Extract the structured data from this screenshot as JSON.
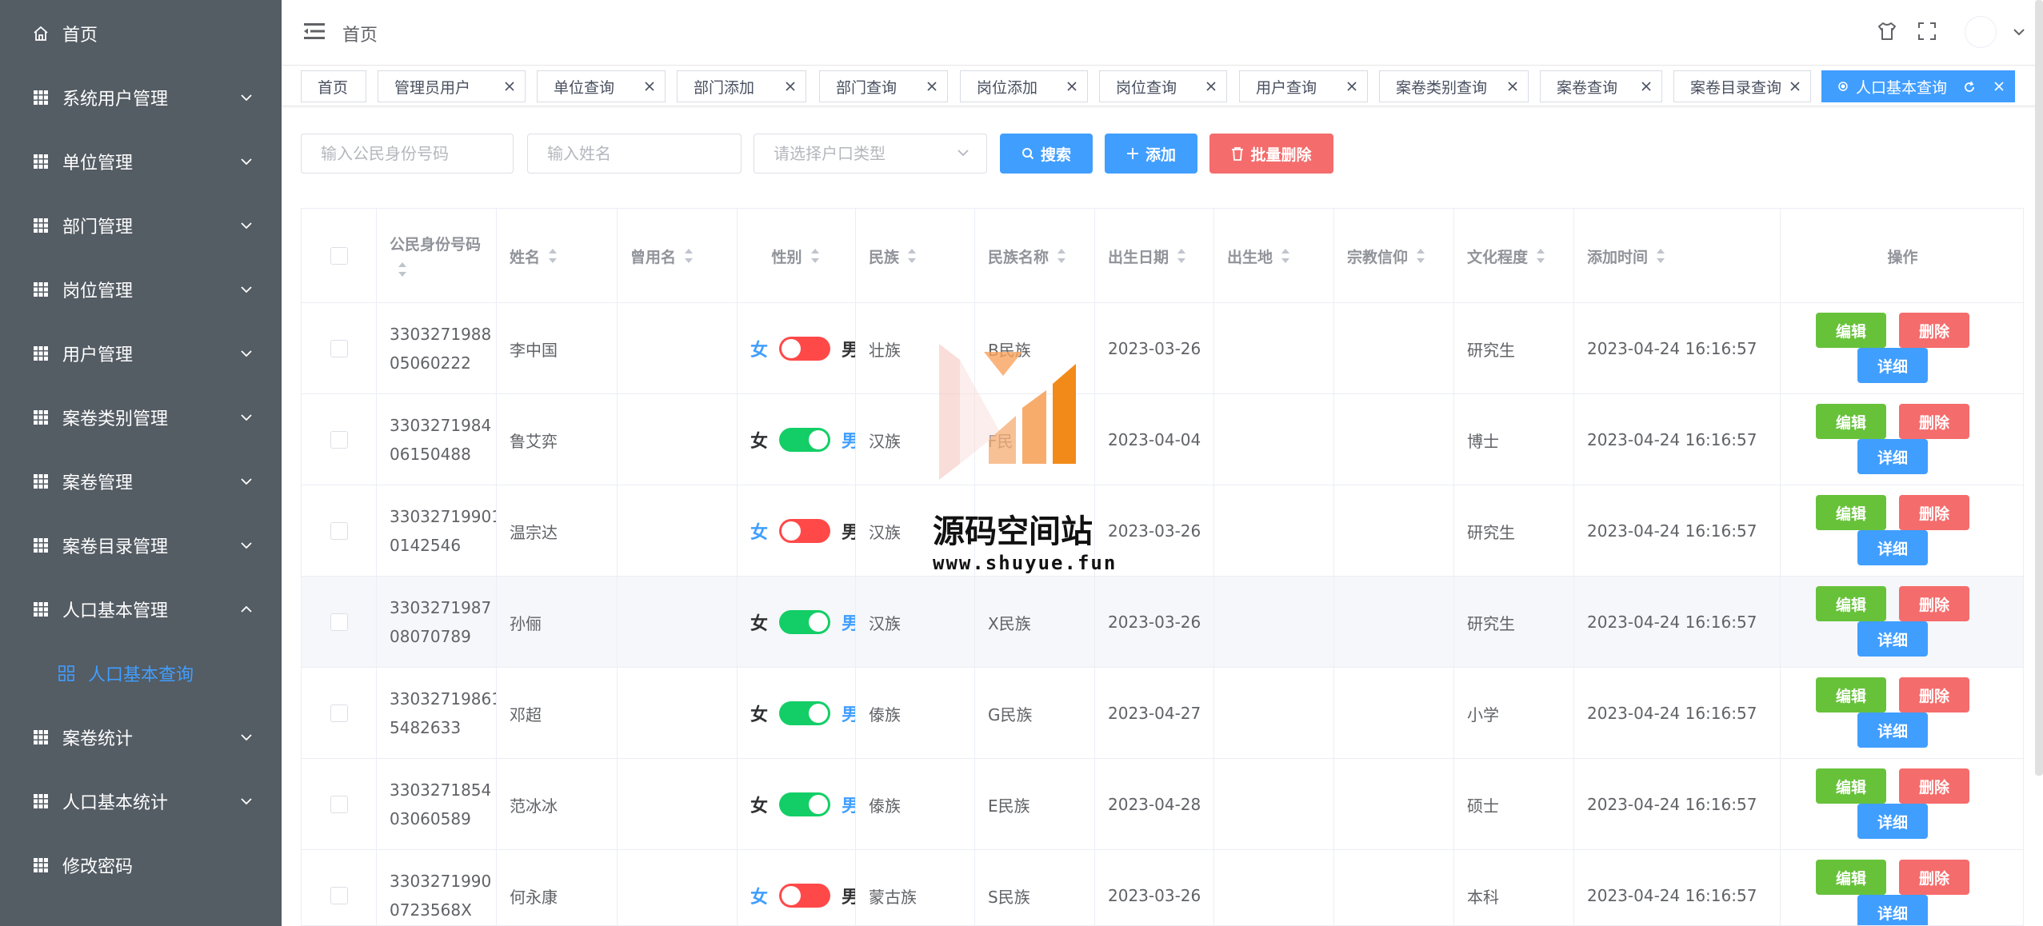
{
  "sidebar": {
    "items": [
      {
        "label": "首页",
        "icon": "home-icon"
      },
      {
        "label": "系统用户管理",
        "icon": "grid-icon"
      },
      {
        "label": "单位管理",
        "icon": "grid-icon"
      },
      {
        "label": "部门管理",
        "icon": "grid-icon"
      },
      {
        "label": "岗位管理",
        "icon": "grid-icon"
      },
      {
        "label": "用户管理",
        "icon": "grid-icon"
      },
      {
        "label": "案卷类别管理",
        "icon": "grid-icon"
      },
      {
        "label": "案卷管理",
        "icon": "grid-icon"
      },
      {
        "label": "案卷目录管理",
        "icon": "grid-icon"
      },
      {
        "label": "人口基本管理",
        "icon": "grid-icon"
      },
      {
        "label": "人口基本查询",
        "icon": "menu-icon"
      },
      {
        "label": "案卷统计",
        "icon": "grid-icon"
      },
      {
        "label": "人口基本统计",
        "icon": "grid-icon"
      },
      {
        "label": "修改密码",
        "icon": "grid-icon"
      }
    ]
  },
  "header": {
    "breadcrumb": "首页"
  },
  "tags": [
    {
      "label": "首页"
    },
    {
      "label": "管理员用户"
    },
    {
      "label": "单位查询"
    },
    {
      "label": "部门添加"
    },
    {
      "label": "部门查询"
    },
    {
      "label": "岗位添加"
    },
    {
      "label": "岗位查询"
    },
    {
      "label": "用户查询"
    },
    {
      "label": "案卷类别查询"
    },
    {
      "label": "案卷查询"
    },
    {
      "label": "案卷目录查询"
    },
    {
      "label": "人口基本查询"
    }
  ],
  "search": {
    "id_placeholder": "输入公民身份号码",
    "name_placeholder": "输入姓名",
    "household_placeholder": "请选择户口类型",
    "search_label": "搜索",
    "add_label": "添加",
    "batch_delete_label": "批量删除"
  },
  "table": {
    "columns": [
      "公民身份号码",
      "姓名",
      "曾用名",
      "性别",
      "民族",
      "民族名称",
      "出生日期",
      "出生地",
      "宗教信仰",
      "文化程度",
      "添加时间",
      "操作"
    ],
    "gender_female": "女",
    "gender_male": "男",
    "rows": [
      {
        "id1": "3303271988",
        "id2": "05060222",
        "name": "李中国",
        "alias": "",
        "gender_female": true,
        "ethnic": "壮族",
        "ethnic_name": "B民族",
        "birth": "2023-03-26",
        "birthplace": "",
        "religion": "",
        "education": "研究生",
        "added": "2023-04-24 16:16:57"
      },
      {
        "id1": "3303271984",
        "id2": "06150488",
        "name": "鲁艾弈",
        "alias": "",
        "gender_female": false,
        "ethnic": "汉族",
        "ethnic_name": "F民",
        "birth": "2023-04-04",
        "birthplace": "",
        "religion": "",
        "education": "博士",
        "added": "2023-04-24 16:16:57"
      },
      {
        "id1": "33032719901",
        "id2": "0142546",
        "name": "温宗达",
        "alias": "",
        "gender_female": true,
        "ethnic": "汉族",
        "ethnic_name": "",
        "birth": "2023-03-26",
        "birthplace": "",
        "religion": "",
        "education": "研究生",
        "added": "2023-04-24 16:16:57"
      },
      {
        "id1": "3303271987",
        "id2": "08070789",
        "name": "孙俪",
        "alias": "",
        "gender_female": false,
        "ethnic": "汉族",
        "ethnic_name": "X民族",
        "birth": "2023-03-26",
        "birthplace": "",
        "religion": "",
        "education": "研究生",
        "added": "2023-04-24 16:16:57"
      },
      {
        "id1": "33032719861",
        "id2": "5482633",
        "name": "邓超",
        "alias": "",
        "gender_female": false,
        "ethnic": "傣族",
        "ethnic_name": "G民族",
        "birth": "2023-04-27",
        "birthplace": "",
        "religion": "",
        "education": "小学",
        "added": "2023-04-24 16:16:57"
      },
      {
        "id1": "3303271854",
        "id2": "03060589",
        "name": "范冰冰",
        "alias": "",
        "gender_female": false,
        "ethnic": "傣族",
        "ethnic_name": "E民族",
        "birth": "2023-04-28",
        "birthplace": "",
        "religion": "",
        "education": "硕士",
        "added": "2023-04-24 16:16:57"
      },
      {
        "id1": "3303271990",
        "id2": "0723568X",
        "name": "何永康",
        "alias": "",
        "gender_female": true,
        "ethnic": "蒙古族",
        "ethnic_name": "S民族",
        "birth": "2023-03-26",
        "birthplace": "",
        "religion": "",
        "education": "本科",
        "added": "2023-04-24 16:16:57"
      }
    ],
    "actions": {
      "edit": "编辑",
      "delete": "删除",
      "detail": "详细"
    }
  },
  "watermark": {
    "title": "源码空间站",
    "url": "www.shuyue.fun"
  },
  "colors": {
    "sidebar_bg": "#545c64",
    "primary": "#409eff",
    "danger": "#f56c6c",
    "success": "#67c23a",
    "switch_on": "#13ce66",
    "switch_off": "#ff4949"
  }
}
